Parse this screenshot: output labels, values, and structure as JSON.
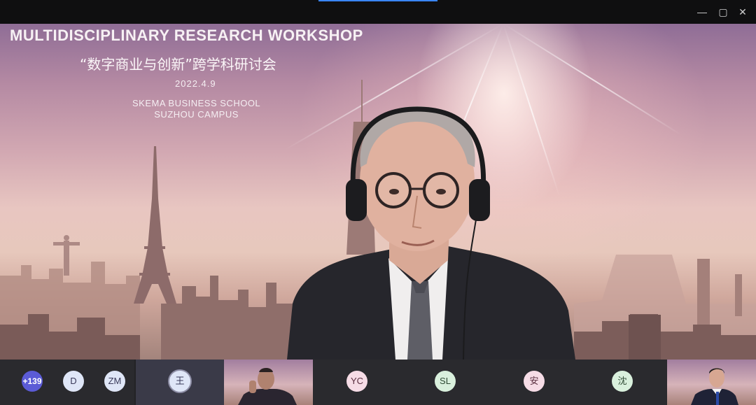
{
  "window": {
    "controls": {
      "minimize": "—",
      "maximize": "▢",
      "close": "✕"
    }
  },
  "slide": {
    "title": "MULTIDISCIPLINARY RESEARCH WORKSHOP",
    "subtitle_cn": "“数字商业与创新”跨学科研讨会",
    "date": "2022.4.9",
    "school_line1": "SKEMA BUSINESS SCHOOL",
    "school_line2": "SUZHOU CAMPUS"
  },
  "participants": {
    "more_count": "+139",
    "tiles": [
      {
        "initials": "D"
      },
      {
        "initials": "ZM"
      },
      {
        "initials": "王"
      },
      {
        "initials": "YC"
      },
      {
        "initials": "SL"
      },
      {
        "initials": "安"
      },
      {
        "initials": "沈"
      }
    ]
  },
  "colors": {
    "accent": "#3a86ff",
    "more_badge": "#5b5bd6",
    "strip_bg": "#232326"
  }
}
